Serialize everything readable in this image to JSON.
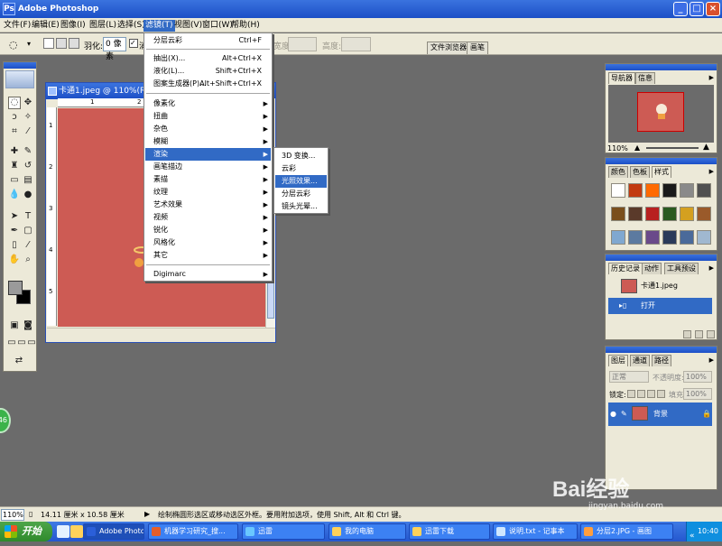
{
  "window": {
    "title": "Adobe Photoshop",
    "app_icon": "Ps",
    "min": "_",
    "max": "□",
    "close": "×"
  },
  "menubar": [
    {
      "label": "文件(F)"
    },
    {
      "label": "编辑(E)"
    },
    {
      "label": "图像(I)"
    },
    {
      "label": "图层(L)"
    },
    {
      "label": "选择(S)"
    },
    {
      "label": "滤镜(T)"
    },
    {
      "label": "视图(V)"
    },
    {
      "label": "窗口(W)"
    },
    {
      "label": "帮助(H)"
    }
  ],
  "options": {
    "feather_label": "羽化:",
    "feather_value": "0 像素",
    "antialias": "消",
    "width_label": "宽度:",
    "height_label": "高度:",
    "tab_browser": "文件浏览器",
    "tab_brushes": "画笔"
  },
  "document": {
    "title": "卡通1.jpeg @ 110%(RGB)",
    "ruler_h": [
      "1",
      "2",
      "3",
      "4"
    ],
    "ruler_v": [
      "1",
      "2",
      "3",
      "4",
      "5"
    ],
    "canvas_color": "#cd5b54"
  },
  "filter_menu": {
    "items": [
      {
        "label": "分层云彩",
        "shortcut": "Ctrl+F"
      },
      {
        "label": "抽出(X)...",
        "shortcut": "Alt+Ctrl+X"
      },
      {
        "label": "液化(L)...",
        "shortcut": "Shift+Ctrl+X"
      },
      {
        "label": "图案生成器(P)...",
        "shortcut": "Alt+Shift+Ctrl+X"
      },
      {
        "label": "像素化"
      },
      {
        "label": "扭曲"
      },
      {
        "label": "杂色"
      },
      {
        "label": "模糊"
      },
      {
        "label": "渲染"
      },
      {
        "label": "画笔描边"
      },
      {
        "label": "素描"
      },
      {
        "label": "纹理"
      },
      {
        "label": "艺术效果"
      },
      {
        "label": "视频"
      },
      {
        "label": "锐化"
      },
      {
        "label": "风格化"
      },
      {
        "label": "其它"
      },
      {
        "label": "Digimarc"
      }
    ],
    "highlighted": "渲染"
  },
  "render_submenu": {
    "items": [
      "3D 变换...",
      "云彩",
      "光照效果...",
      "分层云彩",
      "镜头光晕..."
    ],
    "highlighted": "光照效果..."
  },
  "navigator_panel": {
    "tabs": [
      "导航器",
      "信息"
    ],
    "zoom": "110%"
  },
  "styles_panel": {
    "tabs": [
      "颜色",
      "色板",
      "样式"
    ],
    "swatches": [
      "#ffffff",
      "#c23a10",
      "#ff6a00",
      "#1a1a1a",
      "#8a8a8a",
      "#505050",
      "#7a4f1c",
      "#5a3a2a",
      "#b82020",
      "#2a5a20",
      "#d4a020",
      "#9a5a2a",
      "#80a8d0",
      "#5c7aa0",
      "#6a4a8a",
      "#2a3a5a",
      "#4a6a9a",
      "#a0b8d0"
    ]
  },
  "history_panel": {
    "tabs": [
      "历史记录",
      "动作",
      "工具预设"
    ],
    "snapshot": "卡通1.jpeg",
    "step": "打开"
  },
  "layers_panel": {
    "tabs": [
      "图层",
      "通道",
      "路径"
    ],
    "blend": "正常",
    "opacity_label": "不透明度:",
    "opacity": "100%",
    "lock_label": "锁定:",
    "fill_label": "填充:",
    "fill": "100%",
    "layer_name": "背景"
  },
  "status": {
    "zoom": "110%",
    "doc_size": "14.11 厘米 x 10.58 厘米",
    "hint": "绘制椭圆形选区或移动选区外框。要用附加选项，使用 Shift, Alt 和 Ctrl 键。"
  },
  "taskbar": {
    "start": "开始",
    "buttons": [
      "Adobe Photoshop",
      "机器学习研究_搜...",
      "迅雷",
      "我的电脑",
      "迅雷下载",
      "说明.txt - 记事本",
      "分层2.JPG - 画图"
    ],
    "clock": "10:40"
  },
  "badge": "46",
  "watermark": {
    "logo": "Bai经验",
    "url": "jingyan.baidu.com"
  }
}
